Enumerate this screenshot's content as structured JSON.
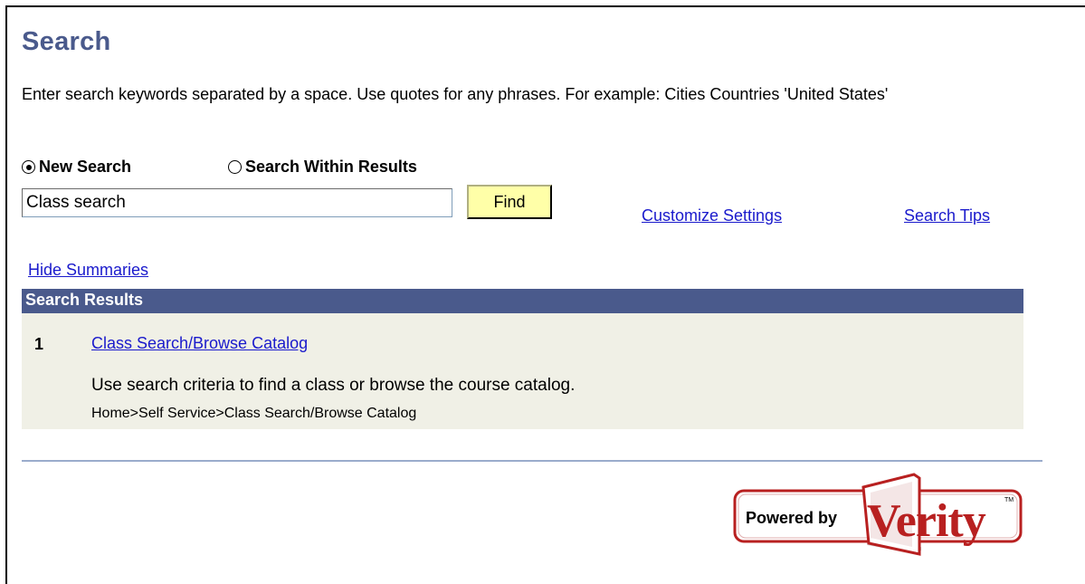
{
  "page": {
    "title": "Search",
    "instructions": "Enter search keywords separated by a space. Use quotes for any phrases. For example: Cities Countries 'United States'"
  },
  "search_mode": {
    "options": [
      {
        "label": "New Search",
        "selected": true
      },
      {
        "label": "Search Within Results",
        "selected": false
      }
    ]
  },
  "search": {
    "value": "Class search",
    "find_label": "Find"
  },
  "links": {
    "customize": "Customize Settings",
    "search_tips": "Search Tips",
    "hide_summaries": "Hide Summaries"
  },
  "results": {
    "header": "Search Results",
    "items": [
      {
        "number": "1",
        "title": "Class Search/Browse Catalog",
        "summary": "Use search criteria to find a class or browse the course catalog.",
        "path": "Home>Self Service>Class Search/Browse Catalog"
      }
    ]
  },
  "footer": {
    "logo_prefix": "Powered by",
    "logo_brand": "Verity",
    "logo_tm": "TM"
  },
  "colors": {
    "title": "#4a5a8c",
    "header_bg": "#4a5a8c",
    "results_bg": "#f0f0e6",
    "link": "#1a1acc",
    "button_bg": "#ffffa8",
    "logo_red": "#b82020"
  }
}
